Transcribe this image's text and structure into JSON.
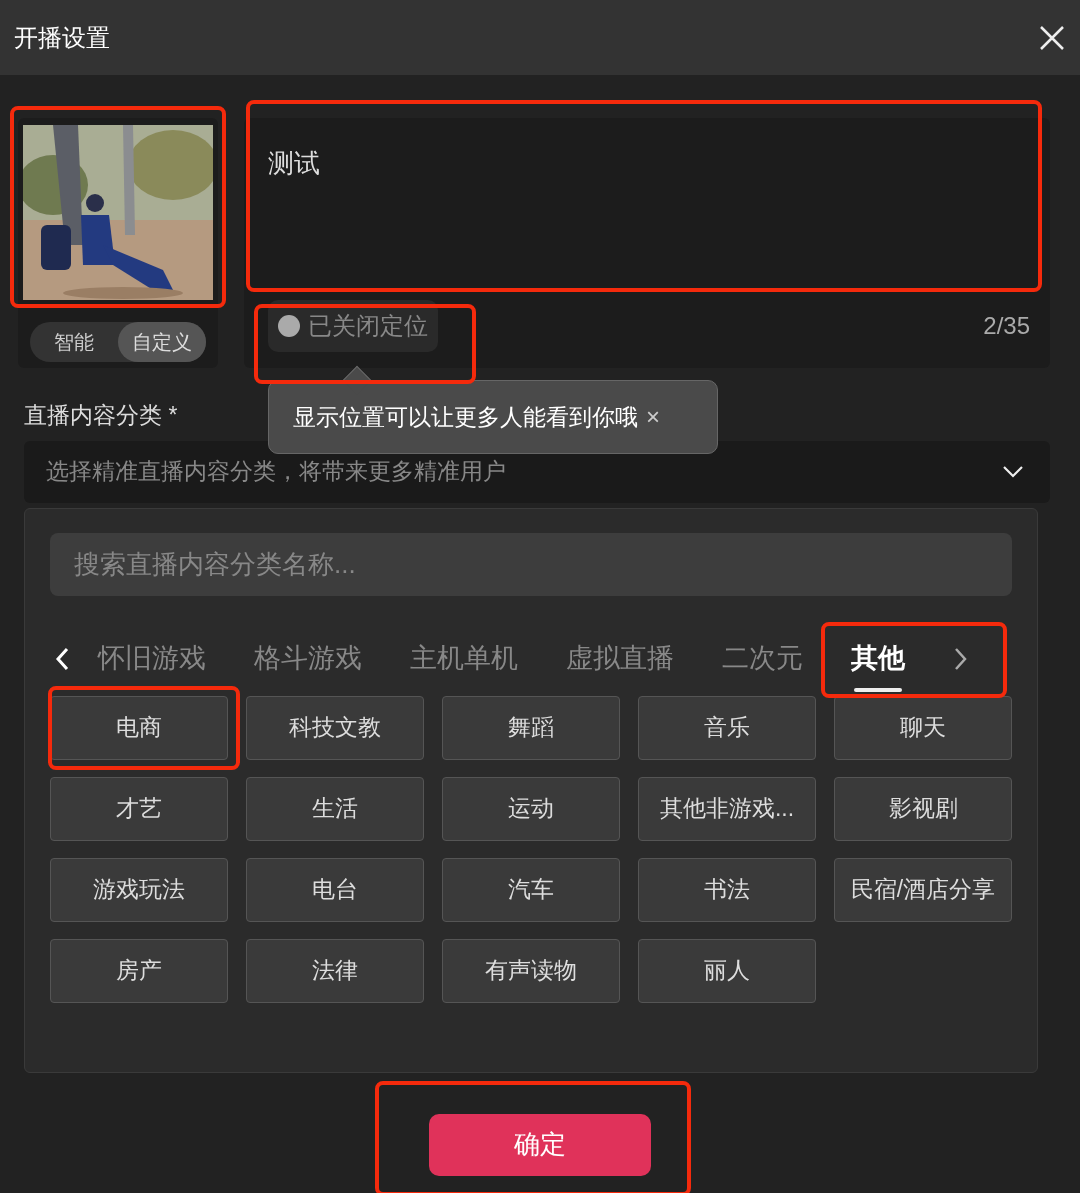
{
  "window": {
    "title": "开播设置"
  },
  "cover": {
    "kind": "picture",
    "highlighted": true,
    "modes": [
      {
        "label": "智能",
        "selected": false
      },
      {
        "label": "自定义",
        "selected": true
      }
    ]
  },
  "title_field": {
    "value": "测试",
    "counter": "2/35",
    "highlighted": true
  },
  "location": {
    "label": "已关闭定位",
    "on": false,
    "highlighted": true
  },
  "tooltip": {
    "text": "显示位置可以让更多人能看到你哦",
    "close": "×"
  },
  "category": {
    "label": "直播内容分类 *",
    "placeholder": "选择精准直播内容分类，将带来更多精准用户",
    "search_placeholder": "搜索直播内容分类名称...",
    "tabs": [
      {
        "label": "怀旧游戏",
        "selected": false,
        "highlighted": false
      },
      {
        "label": "格斗游戏",
        "selected": false,
        "highlighted": false
      },
      {
        "label": "主机单机",
        "selected": false,
        "highlighted": false
      },
      {
        "label": "虚拟直播",
        "selected": false,
        "highlighted": false
      },
      {
        "label": "二次元",
        "selected": false,
        "highlighted": false
      },
      {
        "label": "其他",
        "selected": true,
        "highlighted": true
      }
    ],
    "items": [
      {
        "label": "电商",
        "highlighted": true
      },
      {
        "label": "科技文教",
        "highlighted": false
      },
      {
        "label": "舞蹈",
        "highlighted": false
      },
      {
        "label": "音乐",
        "highlighted": false
      },
      {
        "label": "聊天",
        "highlighted": false
      },
      {
        "label": "才艺",
        "highlighted": false
      },
      {
        "label": "生活",
        "highlighted": false
      },
      {
        "label": "运动",
        "highlighted": false
      },
      {
        "label": "其他非游戏...",
        "highlighted": false
      },
      {
        "label": "影视剧",
        "highlighted": false
      },
      {
        "label": "游戏玩法",
        "highlighted": false
      },
      {
        "label": "电台",
        "highlighted": false
      },
      {
        "label": "汽车",
        "highlighted": false
      },
      {
        "label": "书法",
        "highlighted": false
      },
      {
        "label": "民宿/酒店分享",
        "highlighted": false
      },
      {
        "label": "房产",
        "highlighted": false
      },
      {
        "label": "法律",
        "highlighted": false
      },
      {
        "label": "有声读物",
        "highlighted": false
      },
      {
        "label": "丽人",
        "highlighted": false
      }
    ]
  },
  "confirm": {
    "label": "确定",
    "highlighted": true
  }
}
